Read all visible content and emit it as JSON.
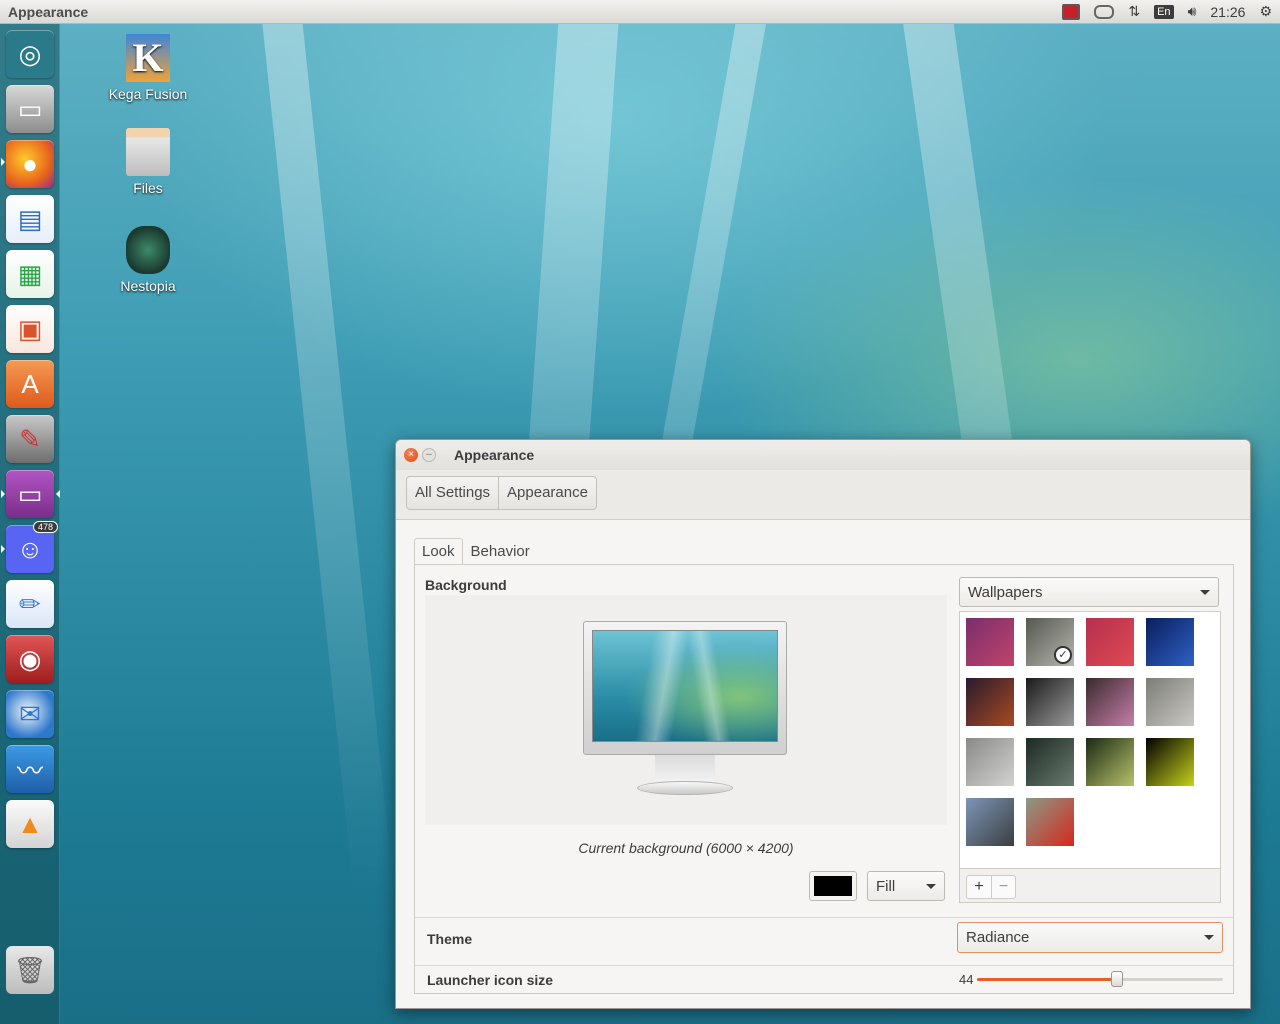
{
  "top_panel": {
    "title": "Appearance",
    "keyboard_layout": "En",
    "clock": "21:26",
    "tray_icons": [
      "record-icon",
      "discord-tray-icon",
      "network-icon",
      "keyboard-icon",
      "volume-icon",
      "gear-icon"
    ]
  },
  "launcher": {
    "items": [
      {
        "name": "dash-home",
        "color": "#2b7a8a"
      },
      {
        "name": "files",
        "color": "#8d8d8d"
      },
      {
        "name": "firefox",
        "color": "#e8651c"
      },
      {
        "name": "libreoffice-writer",
        "color": "#2a6fbd"
      },
      {
        "name": "libreoffice-calc",
        "color": "#28a745"
      },
      {
        "name": "libreoffice-impress",
        "color": "#d9532c"
      },
      {
        "name": "ubuntu-software",
        "color": "#e86b2b"
      },
      {
        "name": "system-settings",
        "color": "#b33636"
      },
      {
        "name": "appearance",
        "color": "#8e3b9a"
      },
      {
        "name": "discord",
        "color": "#5865f2",
        "badge": "478"
      },
      {
        "name": "drawing",
        "color": "#3d7fcf"
      },
      {
        "name": "screen-recorder",
        "color": "#c43b3b"
      },
      {
        "name": "thunderbird",
        "color": "#2e78cc"
      },
      {
        "name": "system-monitor",
        "color": "#1f78c8"
      },
      {
        "name": "vlc",
        "color": "#f08a1c"
      }
    ],
    "trash": "trash"
  },
  "desktop_icons": [
    {
      "label": "Kega Fusion",
      "icon": "kega-fusion-icon"
    },
    {
      "label": "Files",
      "icon": "files-icon"
    },
    {
      "label": "Nestopia",
      "icon": "nestopia-icon"
    }
  ],
  "window": {
    "title": "Appearance",
    "breadcrumbs": [
      "All Settings",
      "Appearance"
    ],
    "tabs": [
      "Look",
      "Behavior"
    ],
    "active_tab": "Look",
    "background": {
      "label": "Background",
      "caption": "Current background (6000 × 4200)",
      "color": "#000000",
      "fill_mode": "Fill",
      "source": "Wallpapers",
      "thumbnails": [
        {
          "colors": [
            "#7a2e6d",
            "#c0446a"
          ]
        },
        {
          "colors": [
            "#55584f",
            "#b7b8b0"
          ],
          "selected": true
        },
        {
          "colors": [
            "#b5304f",
            "#e04a52"
          ]
        },
        {
          "colors": [
            "#0a1e5c",
            "#2f61c7"
          ]
        },
        {
          "colors": [
            "#2a1b2e",
            "#a84a22"
          ]
        },
        {
          "colors": [
            "#1a1a1a",
            "#9a9a9a"
          ]
        },
        {
          "colors": [
            "#3a2a2e",
            "#c67fa8"
          ]
        },
        {
          "colors": [
            "#7d7d78",
            "#c9c8c2"
          ]
        },
        {
          "colors": [
            "#8a8a88",
            "#d2d2d0"
          ]
        },
        {
          "colors": [
            "#1c2a24",
            "#6a7a6e"
          ]
        },
        {
          "colors": [
            "#1b2a15",
            "#b7c26a"
          ]
        },
        {
          "colors": [
            "#000000",
            "#c6d21a"
          ]
        },
        {
          "colors": [
            "#7d95b8",
            "#3a3f3e"
          ]
        },
        {
          "colors": [
            "#8a9a88",
            "#d5281c"
          ]
        }
      ]
    },
    "theme": {
      "label": "Theme",
      "value": "Radiance"
    },
    "launcher_icon_size": {
      "label": "Launcher icon size",
      "value": "44",
      "fraction": 0.57
    }
  }
}
